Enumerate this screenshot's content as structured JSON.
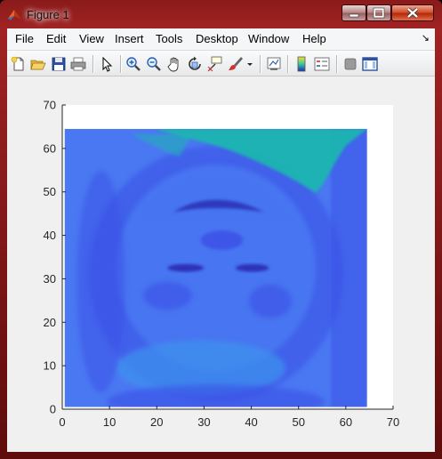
{
  "window": {
    "title": "Figure 1"
  },
  "menu": {
    "items": [
      "File",
      "Edit",
      "View",
      "Insert",
      "Tools",
      "Desktop",
      "Window",
      "Help"
    ],
    "overflow_glyph": "↘"
  },
  "toolbar": {
    "buttons": [
      {
        "name": "new-figure-icon"
      },
      {
        "name": "open-file-icon"
      },
      {
        "name": "save-figure-icon"
      },
      {
        "name": "print-figure-icon"
      },
      {
        "name": "edit-plot-arrow-icon"
      },
      {
        "name": "zoom-in-icon"
      },
      {
        "name": "zoom-out-icon"
      },
      {
        "name": "pan-hand-icon"
      },
      {
        "name": "rotate-3d-icon"
      },
      {
        "name": "data-cursor-icon"
      },
      {
        "name": "brush-icon"
      },
      {
        "name": "link-plot-icon"
      },
      {
        "name": "insert-colorbar-icon"
      },
      {
        "name": "insert-legend-icon"
      },
      {
        "name": "hide-plot-tools-icon"
      },
      {
        "name": "show-plot-tools-icon"
      }
    ]
  },
  "chart_data": {
    "type": "heatmap",
    "title": "",
    "xlabel": "",
    "ylabel": "",
    "xlim": [
      0,
      70
    ],
    "ylim": [
      0,
      70
    ],
    "x_ticks": [
      0,
      10,
      20,
      30,
      40,
      50,
      60,
      70
    ],
    "y_ticks": [
      0,
      10,
      20,
      30,
      40,
      50,
      60,
      70
    ],
    "image_extent": {
      "x": [
        0.5,
        64.5
      ],
      "y": [
        0.5,
        64.5
      ]
    },
    "grid": false,
    "colors": {
      "low": "#3b4fe6",
      "mid": "#4a78f2",
      "high": "#1fb6b0",
      "background": "#ffffff"
    }
  }
}
